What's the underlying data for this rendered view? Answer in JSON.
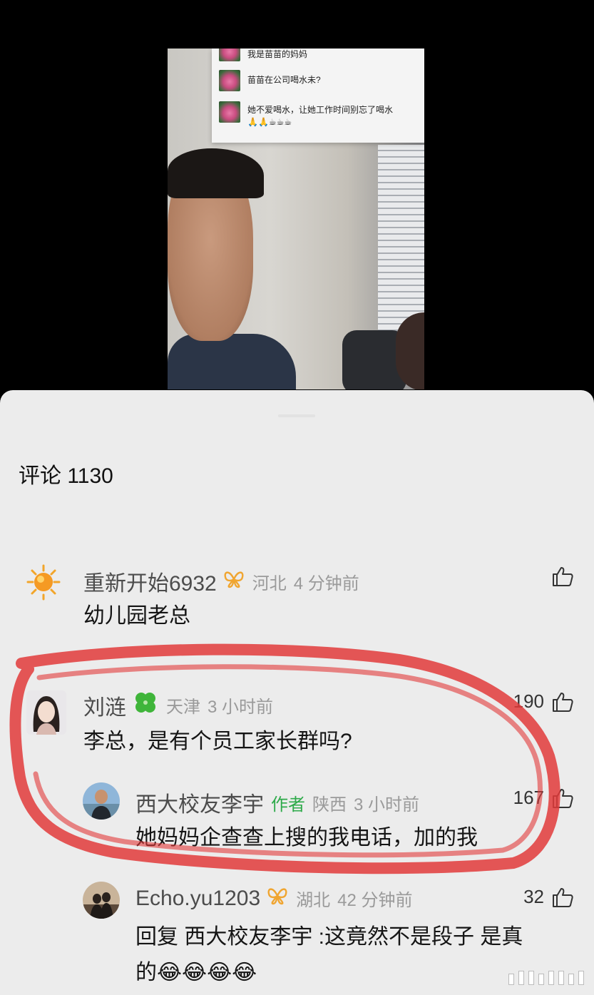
{
  "video": {
    "chat": [
      {
        "text": "我是苗苗的妈妈"
      },
      {
        "text": "苗苗在公司喝水未?"
      },
      {
        "text": "她不爱喝水，让她工作时间别忘了喝水🙏🙏☕☕☕"
      }
    ]
  },
  "comments_header": {
    "label": "评论 1130"
  },
  "comments": [
    {
      "name": "重新开始6932",
      "badge_icon": "butterfly-badge-icon",
      "location": "河北",
      "time": "4 分钟前",
      "text": "幼儿园老总",
      "likes": ""
    },
    {
      "name": "刘涟",
      "badge_icon": "clover-badge-icon",
      "location": "天津",
      "time": "3 小时前",
      "text": "李总，是有个员工家长群吗?",
      "likes": "190"
    }
  ],
  "replies": [
    {
      "name": "西大校友李宇",
      "author_tag": "作者",
      "location": "陕西",
      "time": "3 小时前",
      "text": "她妈妈企查查上搜的我电话，加的我",
      "likes": "167"
    },
    {
      "name": "Echo.yu1203",
      "badge_icon": "butterfly-badge-icon",
      "location": "湖北",
      "time": "42 分钟前",
      "text_line1": "回复 西大校友李宇 :这竟然不是段子 是真",
      "text_line2": "的😂😂😂😂",
      "likes": "32"
    }
  ],
  "colors": {
    "sheet_bg": "#ececec",
    "annotation_red": "#e23b3b",
    "author_green": "#2eaa4a"
  }
}
